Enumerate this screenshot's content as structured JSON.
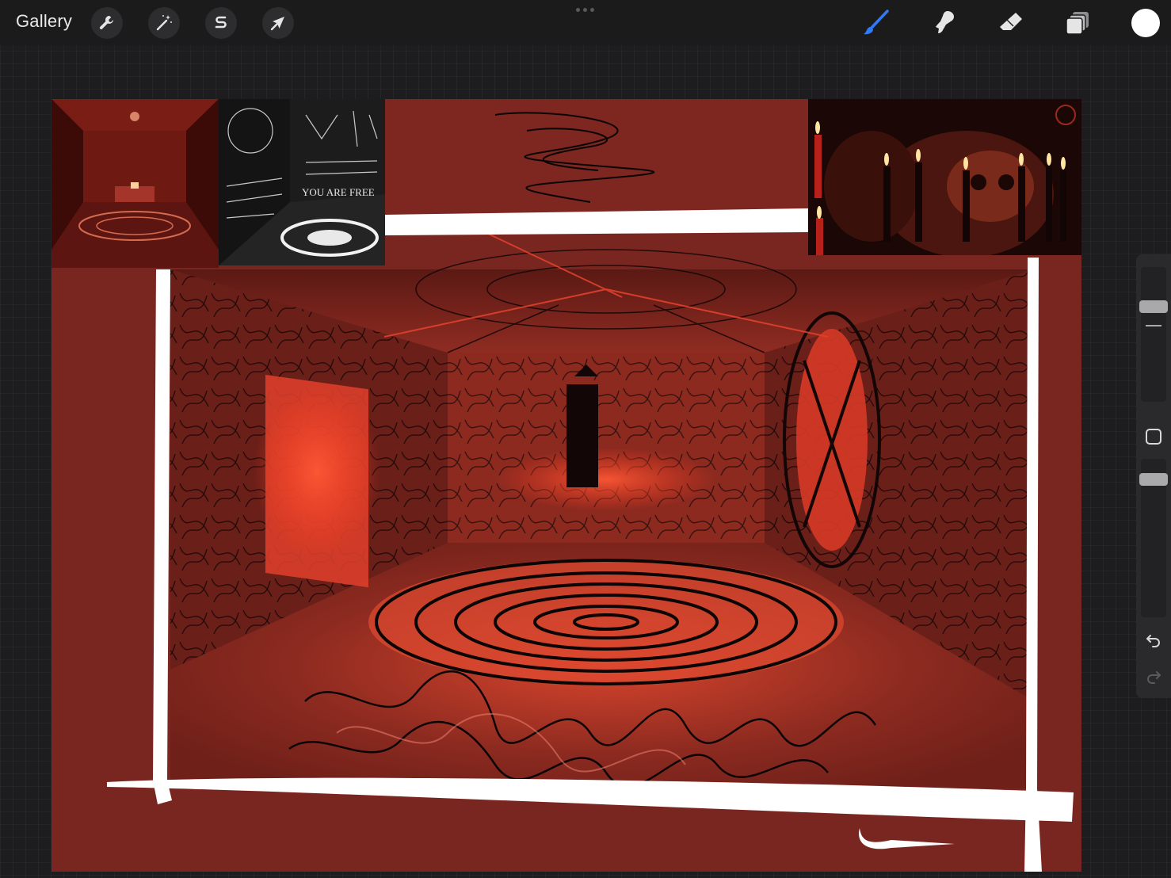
{
  "toolbar": {
    "gallery_label": "Gallery",
    "left_tools": [
      {
        "name": "actions",
        "icon": "wrench-icon"
      },
      {
        "name": "adjustments",
        "icon": "magic-wand-icon"
      },
      {
        "name": "selection",
        "icon": "selection-s-icon"
      },
      {
        "name": "transform",
        "icon": "arrow-cursor-icon"
      }
    ],
    "right_tools": [
      {
        "name": "brush",
        "icon": "brush-icon",
        "active": true
      },
      {
        "name": "smudge",
        "icon": "smudge-icon",
        "active": false
      },
      {
        "name": "eraser",
        "icon": "eraser-icon",
        "active": false
      },
      {
        "name": "layers",
        "icon": "layers-icon",
        "active": false
      }
    ],
    "accent_color": "#2f7bf6",
    "current_color": "#ffffff"
  },
  "canvas": {
    "description_colors": {
      "background": "#7a2620",
      "highlight": "#e0412c",
      "ink": "#0b0505",
      "frame": "#ffffff"
    },
    "reference_images": [
      {
        "name": "red-temple-reference",
        "icon": "photo"
      },
      {
        "name": "black-rune-room-reference",
        "icon": "photo",
        "visible_text": "YOU ARE FREE"
      },
      {
        "name": "candles-skull-reference",
        "icon": "photo"
      }
    ]
  },
  "sidebar": {
    "brush_size": 0.88,
    "opacity": 0.7,
    "undo_icon": "undo-icon",
    "redo_icon": "redo-icon",
    "modify_icon": "square-icon"
  }
}
